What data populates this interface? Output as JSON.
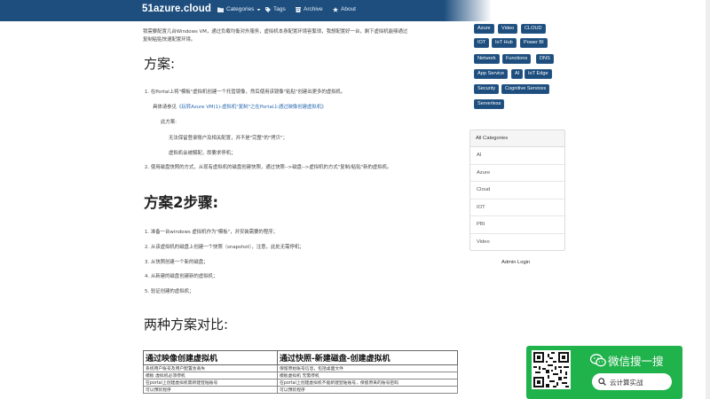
{
  "navbar": {
    "brand": "51azure.cloud",
    "items": [
      {
        "label": "Categories",
        "icon": "folder-icon"
      },
      {
        "label": "Tags",
        "icon": "tag-icon"
      },
      {
        "label": "Archive",
        "icon": "archive-icon"
      },
      {
        "label": "About",
        "icon": "star-icon"
      }
    ]
  },
  "article": {
    "intro_line1": "我需要配置几台Windows VM，通过负载均衡对外服务，虚拟机本身配置环境容繁琐，我想配置好一台，剩下虚拟机能够通过",
    "intro_line2": "复制粘贴快速配置环境。",
    "section1_title": "方案:",
    "s1_item1": "1. 在Portal上将\"模板\"虚拟机创建一个托管镜像，然后使用该镜像\"粘贴\"创建出更多的虚拟机。",
    "s1_ref_prefix": "具体请参见",
    "s1_ref_link": "《玩转Azure VM(1)-虚拟机\"复制\"之在Portal上通过映像创建虚拟机》",
    "s1_scheme": "此方案:",
    "s1_note1": "无法保留登录账户及相关配置，并不是\"完整\"的\"拷贝\"；",
    "s1_note2": "虚拟机会被解配，即要求停机；",
    "s1_item2": "2. 使用磁盘快照的方式，从现有虚拟机的磁盘创建快照，通过快照-->磁盘-->虚拟机的方式\"复制/粘贴\"新的虚拟机。",
    "section2_title": "方案2步骤:",
    "steps": [
      "1. 准备一台windows 虚拟机作为\"模板\"，并安装需要的程序；",
      "2. 从该虚拟机的磁盘上创建一个快照（snapshot），注意，此处无需停机；",
      "3. 从快照创建一个新的磁盘；",
      "4. 从新建的磁盘创建新的虚拟机；",
      "5. 验证创建的虚拟机；"
    ],
    "section3_title": "两种方案对比:",
    "table": {
      "headers": [
        "通过映像创建虚拟机",
        "通过快照-新建磁盘-创建虚拟机"
      ],
      "rows": [
        [
          "系统用户账号及用户配置会丢失",
          "保留原始账号信息，包括桌面文件"
        ],
        [
          "模板 虚拟机必须停机",
          "模板虚拟机 无需停机"
        ],
        [
          "在portal上创建虚拟机需新建登陆账号",
          "在portal上创建虚拟机不能新建登陆账号，保留原来的账号密码"
        ],
        [
          "可以预装程序",
          "可以预装程序"
        ]
      ]
    }
  },
  "sidebar": {
    "tags": [
      "Azure",
      "Video",
      "CLOUD",
      "IOT",
      "IoT Hub",
      "Power BI",
      "Network",
      "Functions",
      "DNS",
      "App Service",
      "AI",
      "IoT Edge",
      "Security",
      "Cognitive Services",
      "Serverless"
    ],
    "categories_title": "All Categories",
    "categories": [
      "AI",
      "Azure",
      "Cloud",
      "IOT",
      "PBI",
      "Video"
    ],
    "admin_login": "Admin Login"
  },
  "wechat": {
    "title": "微信搜一搜",
    "search_text": "云计算实战"
  },
  "colors": {
    "navbar": "#1d4e7e",
    "tag_bg": "#1d4e7e",
    "link": "#2a6ab0",
    "wechat_green": "#20b24b"
  }
}
